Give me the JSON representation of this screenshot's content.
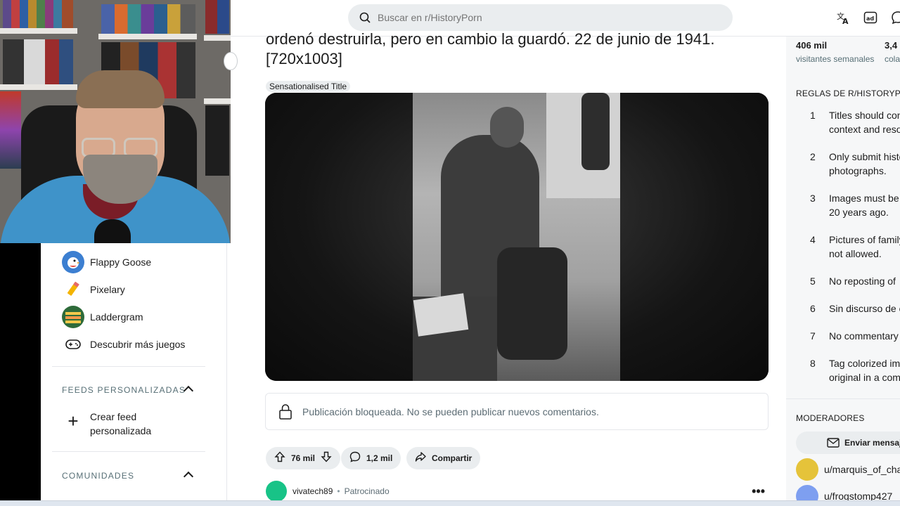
{
  "search": {
    "placeholder": "Buscar en r/HistoryPorn"
  },
  "topbar": {
    "translate_icon": "translate-icon",
    "ad_icon": "advertise-icon",
    "chat_icon": "chat-icon"
  },
  "post": {
    "title_line1": "ordenó destruirla, pero en cambio la guardó. 22 de junio de 1941.",
    "title_line2": "[720x1003]",
    "flair": "Sensationalised Title",
    "locked_text": "Publicación bloqueada. No se pueden publicar nuevos comentarios.",
    "votes": "76 mil",
    "comments": "1,2 mil",
    "share": "Compartir"
  },
  "sponsored": {
    "user": "vivatech89",
    "tag": "Patrocinado"
  },
  "sidebar": {
    "games": [
      {
        "label": "Flappy Goose",
        "icon": "goose-icon"
      },
      {
        "label": "Pixelary",
        "icon": "pencil-icon"
      },
      {
        "label": "Laddergram",
        "icon": "ladder-icon"
      },
      {
        "label": "Descubrir más juegos",
        "icon": "gamepad-icon"
      }
    ],
    "custom_feeds_header": "FEEDS PERSONALIZADAS",
    "create_feed_line1": "Crear feed",
    "create_feed_line2": "personalizada",
    "communities_header": "COMUNIDADES"
  },
  "right": {
    "visitors_num": "406 mil",
    "visitors_label": "visitantes semanales",
    "contrib_num": "3,4",
    "contrib_label": "cola",
    "rules_header": "REGLAS DE R/HISTORYPORN",
    "rules": [
      {
        "n": "1",
        "line1": "Titles should con",
        "line2": "context and reso"
      },
      {
        "n": "2",
        "line1": "Only submit histo",
        "line2": "photographs."
      },
      {
        "n": "3",
        "line1": "Images must be",
        "line2": "20 years ago."
      },
      {
        "n": "4",
        "line1": "Pictures of family",
        "line2": "not allowed."
      },
      {
        "n": "5",
        "line1": "No reposting of",
        "line2": ""
      },
      {
        "n": "6",
        "line1": "Sin discurso de c",
        "line2": ""
      },
      {
        "n": "7",
        "line1": "No commentary",
        "line2": ""
      },
      {
        "n": "8",
        "line1": "Tag colorized ima",
        "line2": "original in a com"
      }
    ],
    "moderators_header": "MODERADORES",
    "send_message": "Enviar mensaje",
    "mods": [
      "u/marquis_of_chac",
      "u/frogstomp427"
    ]
  },
  "colors": {
    "accent": "#0a449b",
    "sidebar_bg": "#f6f7f8",
    "chip_bg": "#eaedef"
  }
}
